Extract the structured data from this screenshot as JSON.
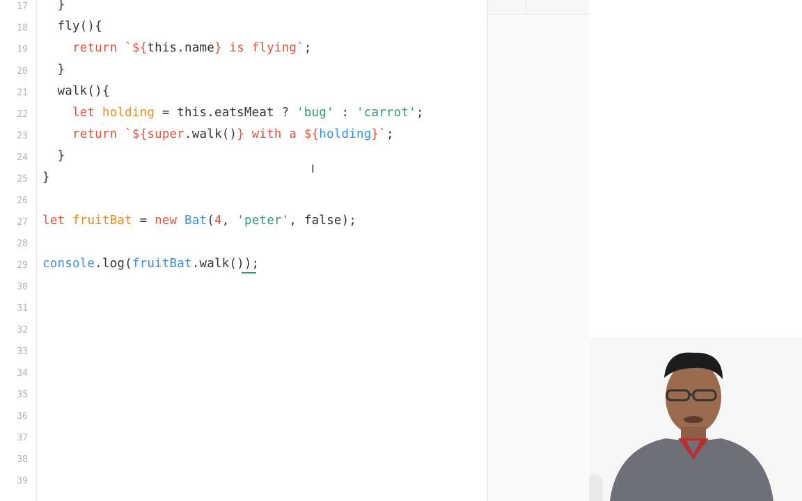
{
  "editor": {
    "lines": [
      {
        "num": "17",
        "tokens": [
          {
            "t": "  }",
            "c": "fn"
          }
        ]
      },
      {
        "num": "18",
        "tokens": [
          {
            "t": "  fly(){",
            "c": "fn"
          }
        ]
      },
      {
        "num": "19",
        "tokens": [
          {
            "t": "    ",
            "c": "fn"
          },
          {
            "t": "return",
            "c": "kw"
          },
          {
            "t": " ",
            "c": "fn"
          },
          {
            "t": "`${",
            "c": "tmpl"
          },
          {
            "t": "this",
            "c": "fn"
          },
          {
            "t": ".",
            "c": "fn"
          },
          {
            "t": "name",
            "c": "fn"
          },
          {
            "t": "} is flying`",
            "c": "tmpl"
          },
          {
            "t": ";",
            "c": "fn"
          }
        ]
      },
      {
        "num": "20",
        "tokens": [
          {
            "t": "  }",
            "c": "fn"
          }
        ]
      },
      {
        "num": "21",
        "tokens": [
          {
            "t": "  walk(){",
            "c": "fn"
          }
        ]
      },
      {
        "num": "22",
        "tokens": [
          {
            "t": "    ",
            "c": "fn"
          },
          {
            "t": "let",
            "c": "kw"
          },
          {
            "t": " ",
            "c": "fn"
          },
          {
            "t": "holding",
            "c": "var"
          },
          {
            "t": " = this.eatsMeat ? ",
            "c": "fn"
          },
          {
            "t": "'bug'",
            "c": "str"
          },
          {
            "t": " : ",
            "c": "fn"
          },
          {
            "t": "'carrot'",
            "c": "str"
          },
          {
            "t": ";",
            "c": "fn"
          }
        ]
      },
      {
        "num": "23",
        "tokens": [
          {
            "t": "    ",
            "c": "fn"
          },
          {
            "t": "return",
            "c": "kw"
          },
          {
            "t": " ",
            "c": "fn"
          },
          {
            "t": "`${",
            "c": "tmpl"
          },
          {
            "t": "super",
            "c": "kw"
          },
          {
            "t": ".walk()",
            "c": "fn"
          },
          {
            "t": "} with a ${",
            "c": "tmpl"
          },
          {
            "t": "holding",
            "c": "obj"
          },
          {
            "t": "}`",
            "c": "tmpl"
          },
          {
            "t": ";",
            "c": "fn"
          }
        ]
      },
      {
        "num": "24",
        "tokens": [
          {
            "t": "  }",
            "c": "fn"
          }
        ]
      },
      {
        "num": "25",
        "tokens": [
          {
            "t": "}",
            "c": "fn"
          }
        ]
      },
      {
        "num": "26",
        "tokens": []
      },
      {
        "num": "27",
        "tokens": [
          {
            "t": "let",
            "c": "kw"
          },
          {
            "t": " ",
            "c": "fn"
          },
          {
            "t": "fruitBat",
            "c": "var"
          },
          {
            "t": " = ",
            "c": "fn"
          },
          {
            "t": "new",
            "c": "kw"
          },
          {
            "t": " ",
            "c": "fn"
          },
          {
            "t": "Bat",
            "c": "cls"
          },
          {
            "t": "(",
            "c": "fn"
          },
          {
            "t": "4",
            "c": "num"
          },
          {
            "t": ", ",
            "c": "fn"
          },
          {
            "t": "'peter'",
            "c": "str"
          },
          {
            "t": ", ",
            "c": "fn"
          },
          {
            "t": "false",
            "c": "fn"
          },
          {
            "t": ");",
            "c": "fn"
          }
        ]
      },
      {
        "num": "28",
        "tokens": []
      },
      {
        "num": "29",
        "tokens": [
          {
            "t": "console",
            "c": "obj"
          },
          {
            "t": ".log(",
            "c": "fn"
          },
          {
            "t": "fruitBat",
            "c": "obj"
          },
          {
            "t": ".walk());",
            "c": "fn"
          }
        ]
      },
      {
        "num": "30",
        "tokens": []
      },
      {
        "num": "31",
        "tokens": []
      },
      {
        "num": "32",
        "tokens": []
      },
      {
        "num": "33",
        "tokens": []
      },
      {
        "num": "34",
        "tokens": []
      },
      {
        "num": "35",
        "tokens": []
      },
      {
        "num": "36",
        "tokens": []
      },
      {
        "num": "37",
        "tokens": []
      },
      {
        "num": "38",
        "tokens": []
      },
      {
        "num": "39",
        "tokens": []
      }
    ]
  },
  "icons": {
    "cursor": "text-cursor-icon",
    "cursor_glyph": "I"
  }
}
